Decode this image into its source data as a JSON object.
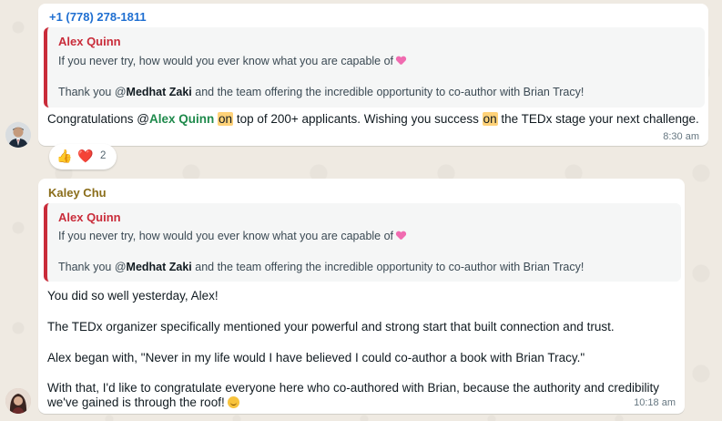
{
  "message1": {
    "sender": "+1 (778) 278-1811",
    "quote": {
      "author": "Alex Quinn",
      "line1": "If you never try, how would you ever know what you are capable of",
      "line2_prefix": "Thank you @",
      "line2_mention": "Medhat Zaki",
      "line2_suffix": " and the team offering the incredible opportunity to co-author with Brian Tracy!"
    },
    "body": {
      "part1": "Congratulations @",
      "mention": "Alex Quinn",
      "space1": " ",
      "hl1": "on",
      "part2": " top of 200+ applicants.  Wishing you success ",
      "hl2": "on",
      "part3": " the TEDx stage your next challenge."
    },
    "time": "8:30 am",
    "reactions": {
      "emoji1": "👍",
      "emoji2": "❤️",
      "count": "2"
    }
  },
  "message2": {
    "sender": "Kaley Chu",
    "quote": {
      "author": "Alex Quinn",
      "line1": "If you never try, how would you ever know what you are capable of",
      "line2_prefix": "Thank you @",
      "line2_mention": "Medhat Zaki",
      "line2_suffix": " and the team offering the incredible opportunity to co-author with Brian Tracy!"
    },
    "body": {
      "line1": "You did so well yesterday, Alex!",
      "line2": "The TEDx organizer specifically mentioned your powerful and strong start that built connection and trust.",
      "line3": "Alex began with, \"Never in my life would I have believed I could co-author a book with Brian Tracy.\"",
      "line4": "With that, I'd like to congratulate everyone here who co-authored with Brian, because the authority and credibility",
      "line5": "we've gained is through the roof!"
    },
    "time": "10:18 am"
  },
  "colors": {
    "sender1": "#1f6fd1",
    "sender2": "#8a6d1a",
    "quote_author": "#c92c3a",
    "mention_green": "#1f8a4c",
    "highlight": "#ffd279"
  }
}
